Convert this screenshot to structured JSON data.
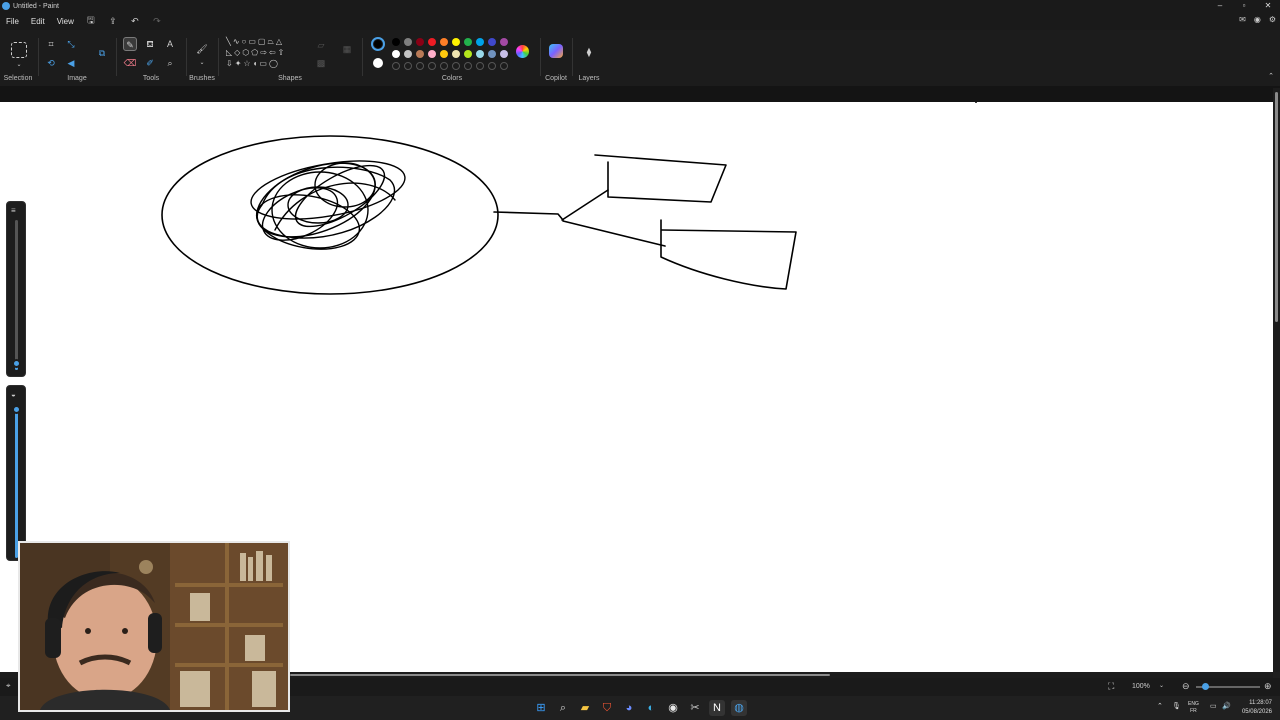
{
  "window": {
    "title": "Untitled - Paint",
    "controls": {
      "minimize": "–",
      "maximize": "▫",
      "close": "✕"
    }
  },
  "menu": {
    "file": "File",
    "edit": "Edit",
    "view": "View"
  },
  "ribbon": {
    "groups": {
      "selection": "Selection",
      "image": "Image",
      "tools": "Tools",
      "brushes": "Brushes",
      "shapes": "Shapes",
      "colors": "Colors",
      "copilot": "Copilot",
      "layers": "Layers"
    },
    "palette_row1": [
      "#000000",
      "#7f7f7f",
      "#880015",
      "#ed1c24",
      "#ff7f27",
      "#fff200",
      "#22b14c",
      "#00a2e8",
      "#3f48cc",
      "#a349a4"
    ],
    "palette_row2": [
      "#ffffff",
      "#c3c3c3",
      "#b97a57",
      "#ffaec9",
      "#ffc90e",
      "#efe4b0",
      "#b5e61d",
      "#99d9ea",
      "#7092be",
      "#c8bfe7"
    ],
    "primary_color": "#000000",
    "secondary_color": "#ffffff"
  },
  "status": {
    "zoom": "100%"
  },
  "taskbar": {
    "lang_top": "ENG",
    "lang_bottom": "FR",
    "time": "11:28:07",
    "date": "05/08/2026"
  }
}
